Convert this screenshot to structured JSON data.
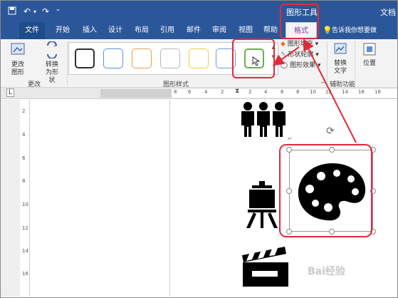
{
  "titlebar": {
    "app_title": "文档",
    "contextual_tab_group": "图形工具"
  },
  "tabs": [
    {
      "label": "文件"
    },
    {
      "label": "开始"
    },
    {
      "label": "插入"
    },
    {
      "label": "设计"
    },
    {
      "label": "布局"
    },
    {
      "label": "引用"
    },
    {
      "label": "邮件"
    },
    {
      "label": "审阅"
    },
    {
      "label": "视图"
    },
    {
      "label": "帮助"
    },
    {
      "label": "格式"
    }
  ],
  "tell_me": "告诉我你想要做",
  "ribbon": {
    "change_shape_label": "更改图形",
    "convert_shape_label": "转换为形状",
    "group_change": "更改",
    "group_graphic_styles": "图形样式",
    "fill": "图形填充",
    "outline": "形状轮廓",
    "effects": "图形效果",
    "alt_text": "替换文字",
    "position": "位置",
    "group_accessibility": "辅助功能"
  },
  "ruler_numbers": [
    "8",
    "6",
    "4",
    "2",
    "2",
    "4",
    "6",
    "8",
    "10",
    "12",
    "14",
    "16",
    "18"
  ],
  "vruler_numbers": [
    "2",
    "4",
    "6",
    "8",
    "10",
    "12",
    "14",
    "16"
  ],
  "watermark": "Bai经验",
  "colors": {
    "accent": "#2b579a",
    "highlight": "#e22a3a",
    "context_tab": "#7a3aa0"
  }
}
